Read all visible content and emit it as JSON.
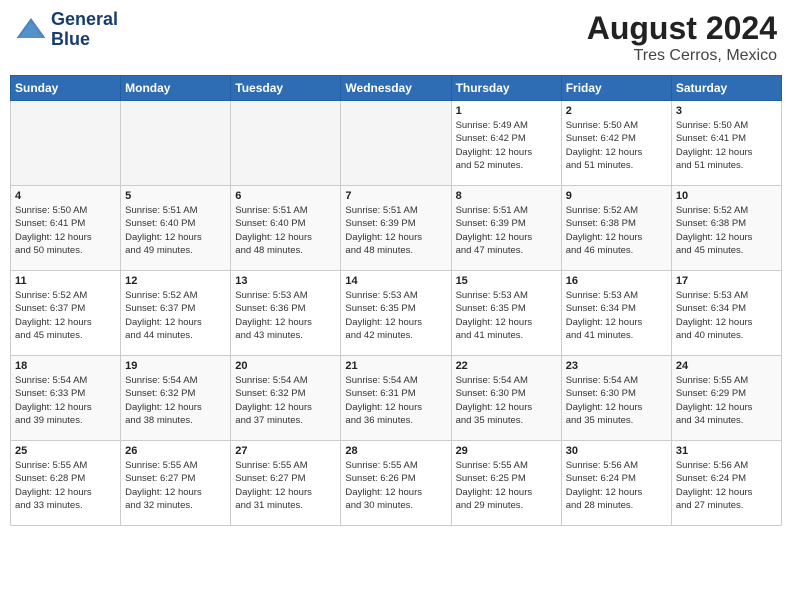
{
  "header": {
    "logo_line1": "General",
    "logo_line2": "Blue",
    "month_year": "August 2024",
    "location": "Tres Cerros, Mexico"
  },
  "weekdays": [
    "Sunday",
    "Monday",
    "Tuesday",
    "Wednesday",
    "Thursday",
    "Friday",
    "Saturday"
  ],
  "weeks": [
    [
      {
        "day": "",
        "info": ""
      },
      {
        "day": "",
        "info": ""
      },
      {
        "day": "",
        "info": ""
      },
      {
        "day": "",
        "info": ""
      },
      {
        "day": "1",
        "info": "Sunrise: 5:49 AM\nSunset: 6:42 PM\nDaylight: 12 hours\nand 52 minutes."
      },
      {
        "day": "2",
        "info": "Sunrise: 5:50 AM\nSunset: 6:42 PM\nDaylight: 12 hours\nand 51 minutes."
      },
      {
        "day": "3",
        "info": "Sunrise: 5:50 AM\nSunset: 6:41 PM\nDaylight: 12 hours\nand 51 minutes."
      }
    ],
    [
      {
        "day": "4",
        "info": "Sunrise: 5:50 AM\nSunset: 6:41 PM\nDaylight: 12 hours\nand 50 minutes."
      },
      {
        "day": "5",
        "info": "Sunrise: 5:51 AM\nSunset: 6:40 PM\nDaylight: 12 hours\nand 49 minutes."
      },
      {
        "day": "6",
        "info": "Sunrise: 5:51 AM\nSunset: 6:40 PM\nDaylight: 12 hours\nand 48 minutes."
      },
      {
        "day": "7",
        "info": "Sunrise: 5:51 AM\nSunset: 6:39 PM\nDaylight: 12 hours\nand 48 minutes."
      },
      {
        "day": "8",
        "info": "Sunrise: 5:51 AM\nSunset: 6:39 PM\nDaylight: 12 hours\nand 47 minutes."
      },
      {
        "day": "9",
        "info": "Sunrise: 5:52 AM\nSunset: 6:38 PM\nDaylight: 12 hours\nand 46 minutes."
      },
      {
        "day": "10",
        "info": "Sunrise: 5:52 AM\nSunset: 6:38 PM\nDaylight: 12 hours\nand 45 minutes."
      }
    ],
    [
      {
        "day": "11",
        "info": "Sunrise: 5:52 AM\nSunset: 6:37 PM\nDaylight: 12 hours\nand 45 minutes."
      },
      {
        "day": "12",
        "info": "Sunrise: 5:52 AM\nSunset: 6:37 PM\nDaylight: 12 hours\nand 44 minutes."
      },
      {
        "day": "13",
        "info": "Sunrise: 5:53 AM\nSunset: 6:36 PM\nDaylight: 12 hours\nand 43 minutes."
      },
      {
        "day": "14",
        "info": "Sunrise: 5:53 AM\nSunset: 6:35 PM\nDaylight: 12 hours\nand 42 minutes."
      },
      {
        "day": "15",
        "info": "Sunrise: 5:53 AM\nSunset: 6:35 PM\nDaylight: 12 hours\nand 41 minutes."
      },
      {
        "day": "16",
        "info": "Sunrise: 5:53 AM\nSunset: 6:34 PM\nDaylight: 12 hours\nand 41 minutes."
      },
      {
        "day": "17",
        "info": "Sunrise: 5:53 AM\nSunset: 6:34 PM\nDaylight: 12 hours\nand 40 minutes."
      }
    ],
    [
      {
        "day": "18",
        "info": "Sunrise: 5:54 AM\nSunset: 6:33 PM\nDaylight: 12 hours\nand 39 minutes."
      },
      {
        "day": "19",
        "info": "Sunrise: 5:54 AM\nSunset: 6:32 PM\nDaylight: 12 hours\nand 38 minutes."
      },
      {
        "day": "20",
        "info": "Sunrise: 5:54 AM\nSunset: 6:32 PM\nDaylight: 12 hours\nand 37 minutes."
      },
      {
        "day": "21",
        "info": "Sunrise: 5:54 AM\nSunset: 6:31 PM\nDaylight: 12 hours\nand 36 minutes."
      },
      {
        "day": "22",
        "info": "Sunrise: 5:54 AM\nSunset: 6:30 PM\nDaylight: 12 hours\nand 35 minutes."
      },
      {
        "day": "23",
        "info": "Sunrise: 5:54 AM\nSunset: 6:30 PM\nDaylight: 12 hours\nand 35 minutes."
      },
      {
        "day": "24",
        "info": "Sunrise: 5:55 AM\nSunset: 6:29 PM\nDaylight: 12 hours\nand 34 minutes."
      }
    ],
    [
      {
        "day": "25",
        "info": "Sunrise: 5:55 AM\nSunset: 6:28 PM\nDaylight: 12 hours\nand 33 minutes."
      },
      {
        "day": "26",
        "info": "Sunrise: 5:55 AM\nSunset: 6:27 PM\nDaylight: 12 hours\nand 32 minutes."
      },
      {
        "day": "27",
        "info": "Sunrise: 5:55 AM\nSunset: 6:27 PM\nDaylight: 12 hours\nand 31 minutes."
      },
      {
        "day": "28",
        "info": "Sunrise: 5:55 AM\nSunset: 6:26 PM\nDaylight: 12 hours\nand 30 minutes."
      },
      {
        "day": "29",
        "info": "Sunrise: 5:55 AM\nSunset: 6:25 PM\nDaylight: 12 hours\nand 29 minutes."
      },
      {
        "day": "30",
        "info": "Sunrise: 5:56 AM\nSunset: 6:24 PM\nDaylight: 12 hours\nand 28 minutes."
      },
      {
        "day": "31",
        "info": "Sunrise: 5:56 AM\nSunset: 6:24 PM\nDaylight: 12 hours\nand 27 minutes."
      }
    ]
  ]
}
